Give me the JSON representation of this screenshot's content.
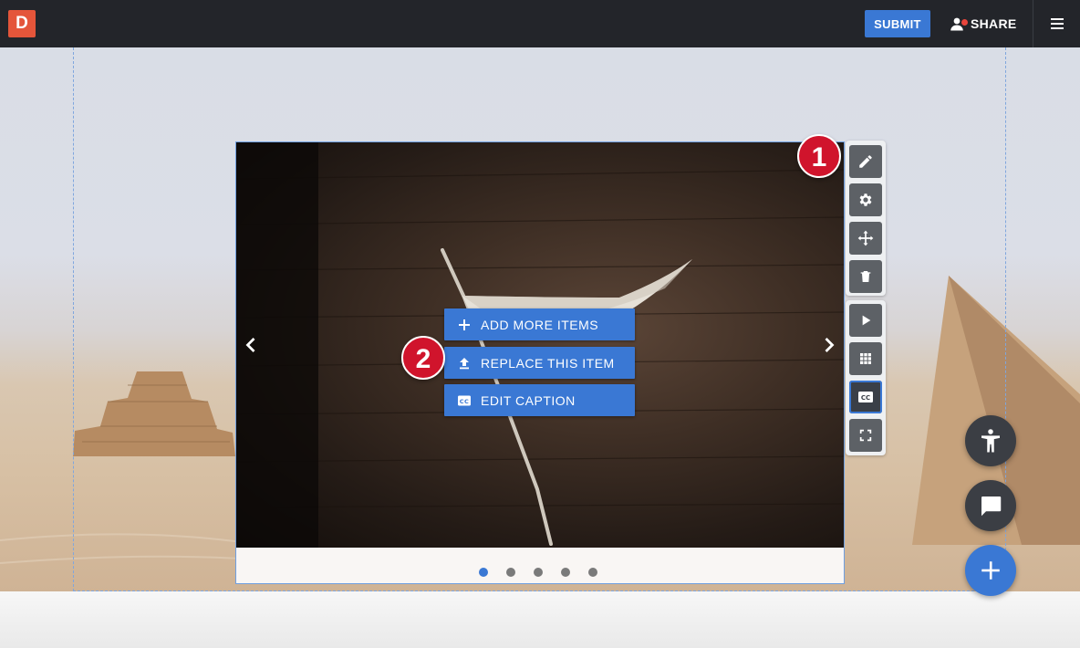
{
  "header": {
    "logo_text": "D",
    "submit_label": "SUBMIT",
    "share_label": "SHARE",
    "icons": {
      "user": "person-icon",
      "menu": "hamburger-menu-icon"
    }
  },
  "slideshow": {
    "actions": [
      {
        "label": "ADD MORE ITEMS",
        "icon": "plus-icon"
      },
      {
        "label": "REPLACE THIS ITEM",
        "icon": "upload-icon"
      },
      {
        "label": "EDIT CAPTION",
        "icon": "closed-caption-icon"
      }
    ],
    "dot_count": 5,
    "active_dot": 0
  },
  "toolbar": {
    "primary": [
      "edit-pencil-icon",
      "settings-gear-icon",
      "move-arrows-icon",
      "delete-trash-icon"
    ],
    "secondary": [
      "play-icon",
      "grid-icon",
      "closed-caption-icon",
      "fullscreen-icon"
    ],
    "active_tool": "closed-caption-icon"
  },
  "badges": [
    "1",
    "2"
  ],
  "colors": {
    "accent": "#3a78d4",
    "header": "#23252a",
    "logo": "#e4553a",
    "badge": "#d0142c"
  }
}
